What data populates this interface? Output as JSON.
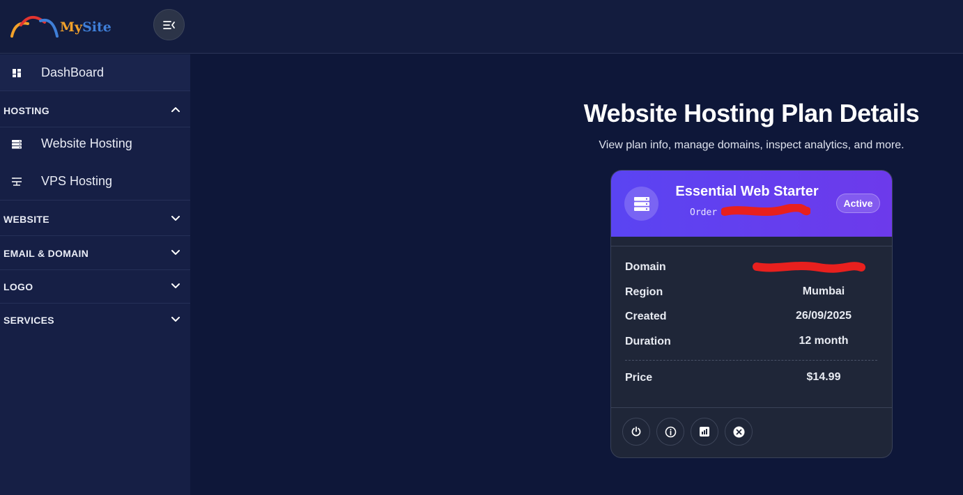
{
  "brand": {
    "name_part1": "My",
    "name_part2": "Site"
  },
  "sidebar": {
    "dashboard_label": "DashBoard",
    "sections": [
      {
        "label": "HOSTING",
        "expanded": true
      },
      {
        "label": "WEBSITE",
        "expanded": false
      },
      {
        "label": "EMAIL & DOMAIN",
        "expanded": false
      },
      {
        "label": "LOGO",
        "expanded": false
      },
      {
        "label": "SERVICES",
        "expanded": false
      }
    ],
    "hosting_items": [
      {
        "label": "Website Hosting",
        "icon": "server-icon"
      },
      {
        "label": "VPS Hosting",
        "icon": "vps-icon"
      }
    ]
  },
  "main": {
    "title": "Website Hosting Plan Details",
    "subtitle": "View plan info, manage domains, inspect analytics, and more."
  },
  "card": {
    "plan_name": "Essential Web Starter",
    "order_label": "Order",
    "status": "Active",
    "rows": [
      {
        "key": "Domain",
        "value": ""
      },
      {
        "key": "Region",
        "value": "Mumbai"
      },
      {
        "key": "Created",
        "value": "26/09/2025"
      },
      {
        "key": "Duration",
        "value": "12 month"
      }
    ],
    "price_label": "Price",
    "price_value": "$14.99",
    "actions": [
      "power-icon",
      "info-icon",
      "analytics-icon",
      "cancel-icon"
    ]
  },
  "colors": {
    "background": "#0e1739",
    "sidebar": "#161f45",
    "card_header_start": "#5a44f2",
    "card_header_end": "#6d3aeb",
    "redaction": "#e8201e"
  }
}
